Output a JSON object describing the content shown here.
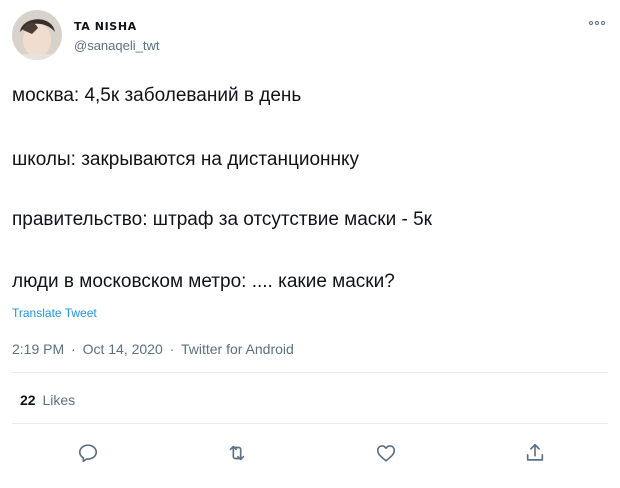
{
  "user": {
    "display_name": "TA NISHA",
    "handle": "@sanaqeli_twt"
  },
  "tweet": {
    "lines": [
      "москва: 4,5к заболеваний в день",
      "школы: закрываются на дистанционнку",
      "правительство: штраф за отсутствие маски - 5к",
      "люди в московском метро: .... какие маски?"
    ],
    "translate_label": "Translate Tweet"
  },
  "meta": {
    "time": "2:19 PM",
    "separator": "·",
    "date": "Oct 14, 2020",
    "source": "Twitter for Android"
  },
  "stats": {
    "likes_count": "22",
    "likes_label": "Likes"
  },
  "icons": {
    "more": "more-options-icon",
    "reply": "reply-icon",
    "retweet": "retweet-icon",
    "like": "heart-icon",
    "share": "share-icon"
  },
  "colors": {
    "link": "#1b95e0",
    "secondary_text": "#5b7083",
    "primary_text": "#0f1419",
    "divider": "#e6ecf0"
  }
}
